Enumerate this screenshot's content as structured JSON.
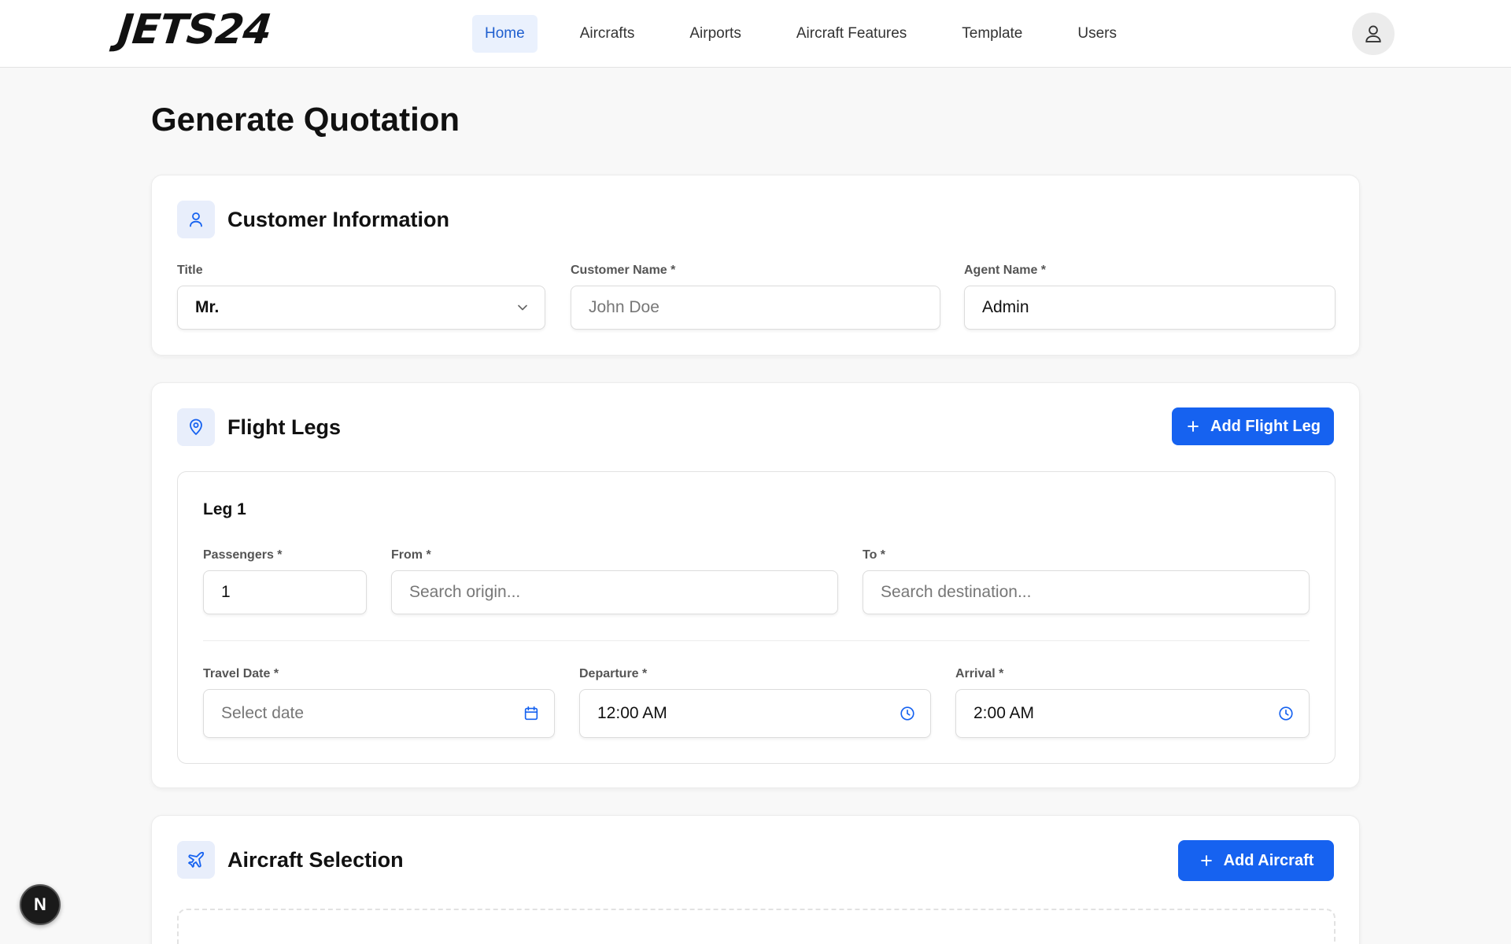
{
  "header": {
    "logo": "JETS24",
    "nav": [
      "Home",
      "Aircrafts",
      "Airports",
      "Aircraft Features",
      "Template",
      "Users"
    ],
    "active_nav": "Home"
  },
  "page": {
    "title": "Generate Quotation"
  },
  "customer": {
    "section_title": "Customer Information",
    "title_label": "Title",
    "title_value": "Mr.",
    "name_label": "Customer Name *",
    "name_placeholder": "John Doe",
    "agent_label": "Agent Name *",
    "agent_value": "Admin"
  },
  "flight_legs": {
    "section_title": "Flight Legs",
    "add_button": "Add Flight Leg",
    "leg": {
      "title": "Leg 1",
      "passengers_label": "Passengers *",
      "passengers_value": "1",
      "from_label": "From *",
      "from_placeholder": "Search origin...",
      "to_label": "To *",
      "to_placeholder": "Search destination...",
      "date_label": "Travel Date *",
      "date_placeholder": "Select date",
      "departure_label": "Departure *",
      "departure_value": "12:00 AM",
      "arrival_label": "Arrival *",
      "arrival_value": "2:00 AM"
    }
  },
  "aircraft": {
    "section_title": "Aircraft Selection",
    "add_button": "Add Aircraft"
  },
  "dev_badge": "N",
  "colors": {
    "primary": "#1662f0",
    "accent_bg": "#e8eefb",
    "nav_active": "#1f5fcf"
  }
}
